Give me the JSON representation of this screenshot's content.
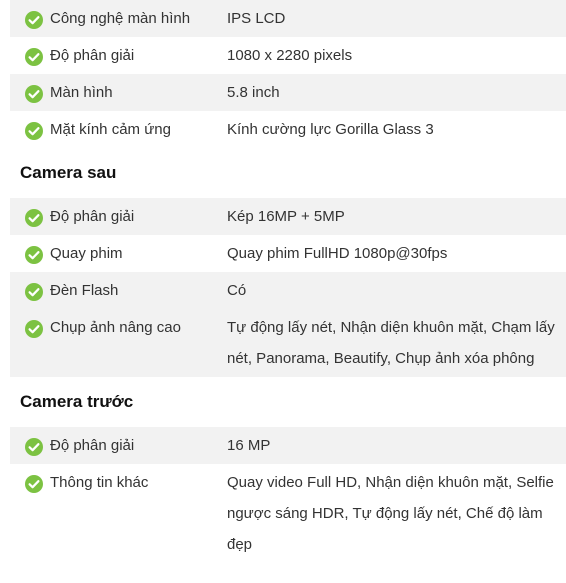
{
  "colors": {
    "check_green": "#7cc242",
    "row_gray": "#f2f2f2"
  },
  "display": {
    "rows": [
      {
        "label": "Công nghệ màn hình",
        "value": "IPS LCD"
      },
      {
        "label": "Độ phân giải",
        "value": "1080 x 2280 pixels"
      },
      {
        "label": "Màn hình",
        "value": "5.8 inch"
      },
      {
        "label": "Mặt kính cảm ứng",
        "value": "Kính cường lực Gorilla Glass 3"
      }
    ]
  },
  "rear_camera": {
    "heading": "Camera sau",
    "rows": [
      {
        "label": "Độ phân giải",
        "value": "Kép 16MP + 5MP"
      },
      {
        "label": "Quay phim",
        "value": "Quay phim FullHD 1080p@30fps"
      },
      {
        "label": "Đèn Flash",
        "value": "Có"
      },
      {
        "label": "Chụp ảnh nâng cao",
        "value": "Tự động lấy nét, Nhận diện khuôn mặt, Chạm lấy nét, Panorama, Beautify, Chụp ảnh xóa phông"
      }
    ]
  },
  "front_camera": {
    "heading": "Camera trước",
    "rows": [
      {
        "label": "Độ phân giải",
        "value": "16 MP"
      },
      {
        "label": "Thông tin khác",
        "value": "Quay video Full HD, Nhận diện khuôn mặt, Selfie ngược sáng HDR, Tự động lấy nét, Chế độ làm đẹp"
      }
    ]
  },
  "icons": {
    "row_icon": "check-circle-icon"
  }
}
